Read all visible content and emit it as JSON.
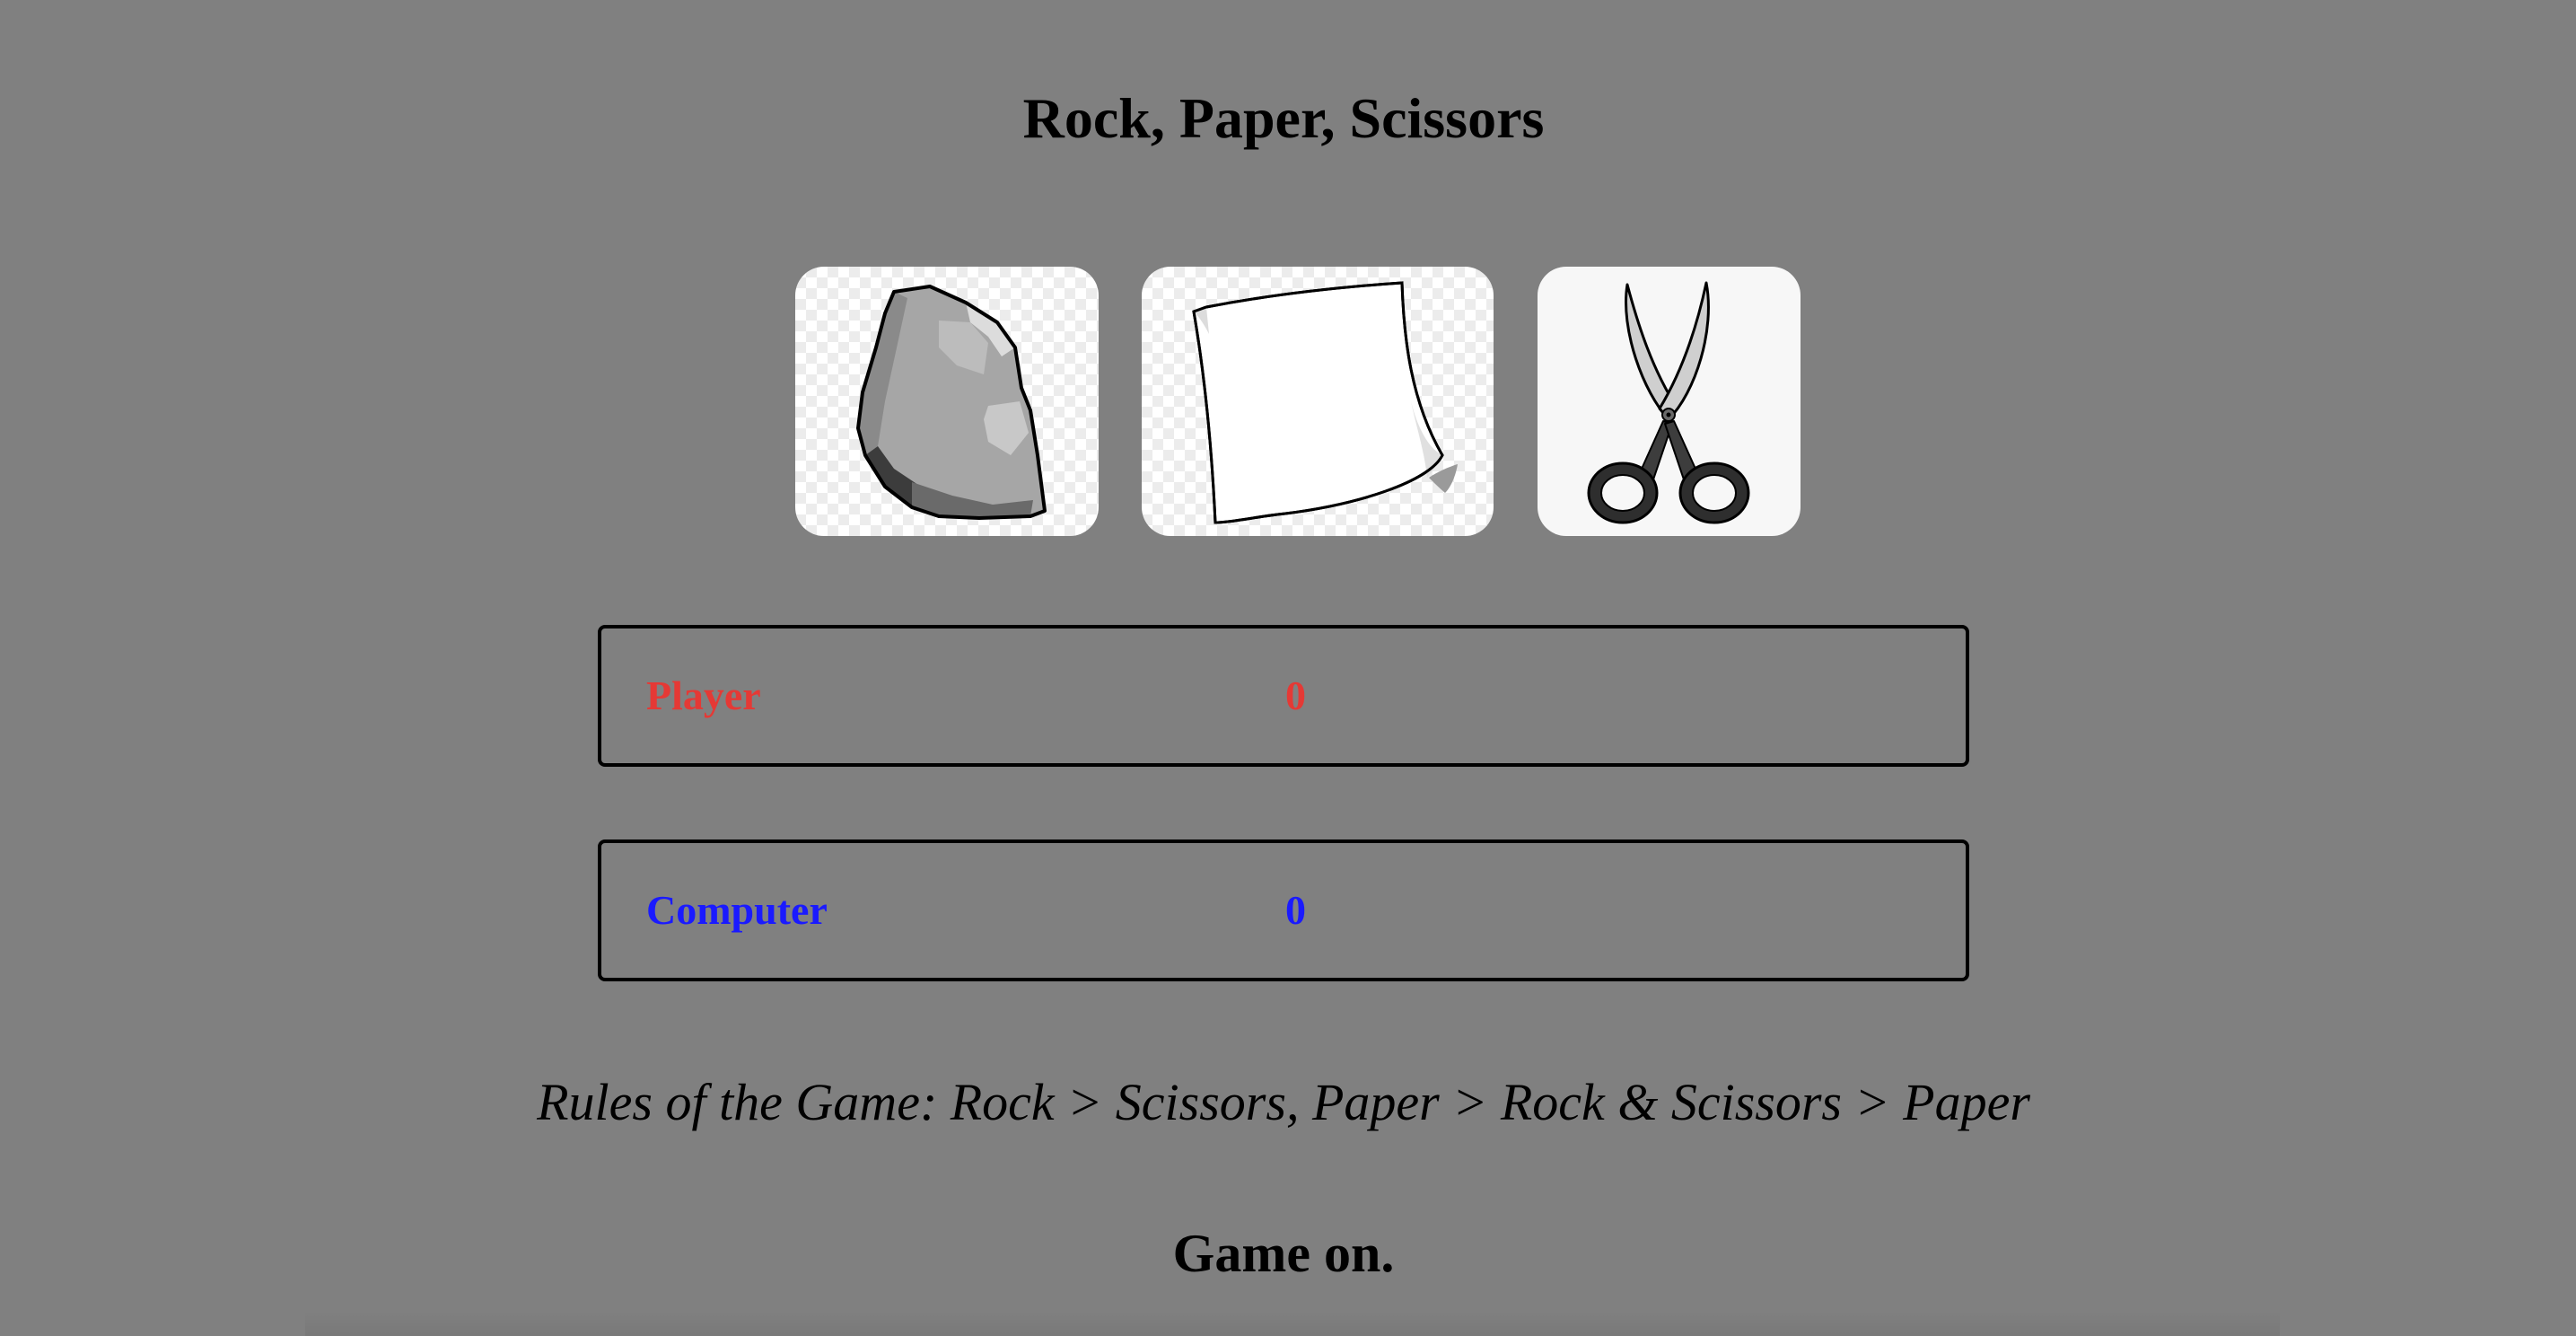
{
  "app": {
    "title": "Rock, Paper, Scissors"
  },
  "choices": [
    {
      "id": "rock",
      "name": "Rock",
      "icon": "rock-icon"
    },
    {
      "id": "paper",
      "name": "Paper",
      "icon": "paper-icon"
    },
    {
      "id": "scissors",
      "name": "Scissors",
      "icon": "scissors-icon"
    }
  ],
  "scores": {
    "player": {
      "label": "Player",
      "value": "0",
      "color": "#e53935"
    },
    "computer": {
      "label": "Computer",
      "value": "0",
      "color": "#1a1aff"
    }
  },
  "rules": {
    "text": "Rules of the Game: Rock > Scissors, Paper > Rock & Scissors > Paper"
  },
  "status": {
    "message": "Game on."
  },
  "colors": {
    "background": "#808080",
    "text": "#000000"
  }
}
